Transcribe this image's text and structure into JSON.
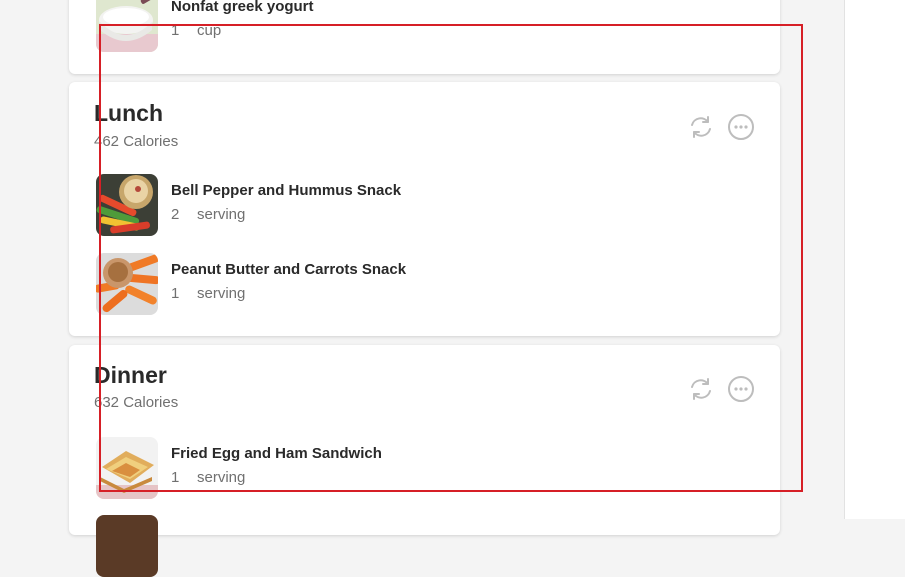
{
  "meals": {
    "breakfast": {
      "items": [
        {
          "name": "Nonfat greek yogurt",
          "amount": "1",
          "unit": "cup",
          "thumb_icon": "yogurt-bowl-thumbnail"
        }
      ]
    },
    "lunch": {
      "title": "Lunch",
      "calories": "462 Calories",
      "actions": [
        "regenerate-icon",
        "more-options-icon"
      ],
      "items": [
        {
          "name": "Bell Pepper and Hummus Snack",
          "amount": "2",
          "unit": "serving",
          "thumb_icon": "hummus-peppers-thumbnail"
        },
        {
          "name": "Peanut Butter and Carrots Snack",
          "amount": "1",
          "unit": "serving",
          "thumb_icon": "peanut-butter-carrots-thumbnail"
        }
      ]
    },
    "dinner": {
      "title": "Dinner",
      "calories": "632 Calories",
      "actions": [
        "regenerate-icon",
        "more-options-icon"
      ],
      "items": [
        {
          "name": "Fried Egg and Ham Sandwich",
          "amount": "1",
          "unit": "serving",
          "thumb_icon": "egg-ham-sandwich-thumbnail"
        }
      ]
    }
  },
  "colors": {
    "page_bg": "#f4f4f4",
    "card_bg": "#ffffff",
    "title_text": "#2a2a2a",
    "muted_text": "#707070",
    "icon_gray": "#bdbdbd",
    "highlight_box": "#d61f26"
  }
}
